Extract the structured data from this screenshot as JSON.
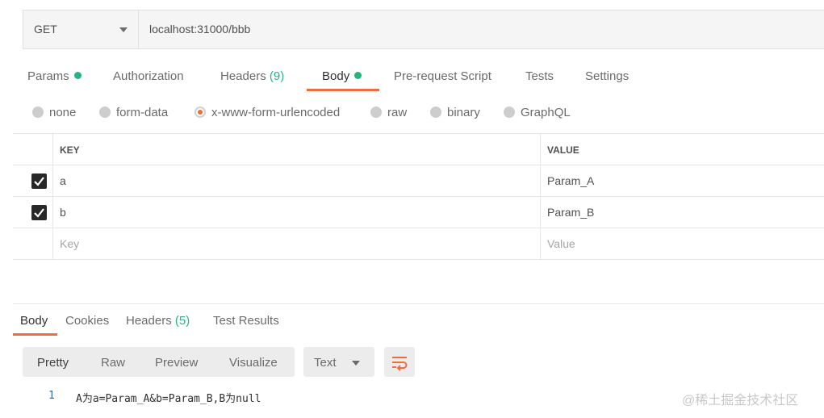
{
  "request": {
    "method": "GET",
    "url": "localhost:31000/bbb"
  },
  "tabs": [
    {
      "label": "Params",
      "dot": true
    },
    {
      "label": "Authorization"
    },
    {
      "label": "Headers",
      "count": "(9)"
    },
    {
      "label": "Body",
      "dot": true,
      "active": true
    },
    {
      "label": "Pre-request Script"
    },
    {
      "label": "Tests"
    },
    {
      "label": "Settings"
    }
  ],
  "body_types": [
    {
      "label": "none"
    },
    {
      "label": "form-data"
    },
    {
      "label": "x-www-form-urlencoded",
      "selected": true
    },
    {
      "label": "raw"
    },
    {
      "label": "binary"
    },
    {
      "label": "GraphQL"
    }
  ],
  "params_table": {
    "headers": {
      "key": "KEY",
      "value": "VALUE"
    },
    "rows": [
      {
        "checked": true,
        "key": "a",
        "value": "Param_A"
      },
      {
        "checked": true,
        "key": "b",
        "value": "Param_B"
      }
    ],
    "placeholder": {
      "key": "Key",
      "value": "Value"
    }
  },
  "response": {
    "tabs": [
      {
        "label": "Body",
        "active": true
      },
      {
        "label": "Cookies"
      },
      {
        "label": "Headers",
        "count": "(5)"
      },
      {
        "label": "Test Results"
      }
    ],
    "formats": [
      "Pretty",
      "Raw",
      "Preview",
      "Visualize"
    ],
    "active_format": "Pretty",
    "type_select": "Text",
    "lines": [
      {
        "number": "1",
        "text": "A为a=Param_A&b=Param_B,B为null"
      }
    ]
  },
  "watermark": "@稀土掘金技术社区",
  "colors": {
    "accent": "#f26b3a",
    "green": "#26b47f",
    "line_number": "#2f6ea5"
  },
  "icons": {
    "method_dropdown": "chevron-down-icon",
    "checkbox": "check-icon",
    "wrap": "wrap-lines-icon"
  }
}
